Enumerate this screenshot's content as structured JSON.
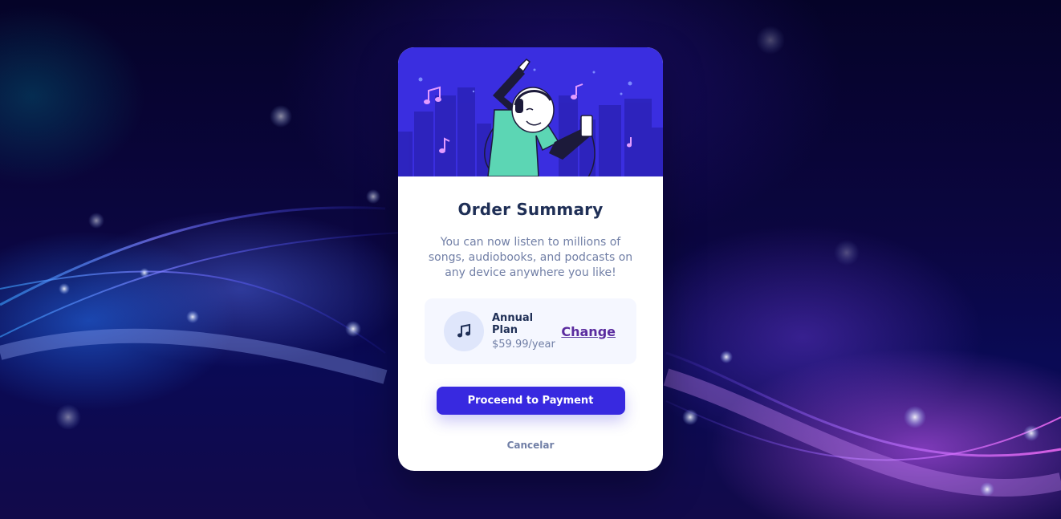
{
  "card": {
    "title": "Order Summary",
    "description": "You can now listen to millions of songs, audiobooks, and podcasts on any device anywhere you like!",
    "hero_image": "person-dancing-with-headphones-illustration"
  },
  "plan": {
    "icon": "music-note-icon",
    "name": "Annual Plan",
    "price": "$59.99/year",
    "change_label": "Change"
  },
  "actions": {
    "pay_label": "Proceend to Payment",
    "cancel_label": "Cancelar"
  },
  "colors": {
    "accent": "#3829e0",
    "title": "#1f2f56",
    "muted": "#717fa6",
    "plan_bg": "#f5f7ff"
  }
}
